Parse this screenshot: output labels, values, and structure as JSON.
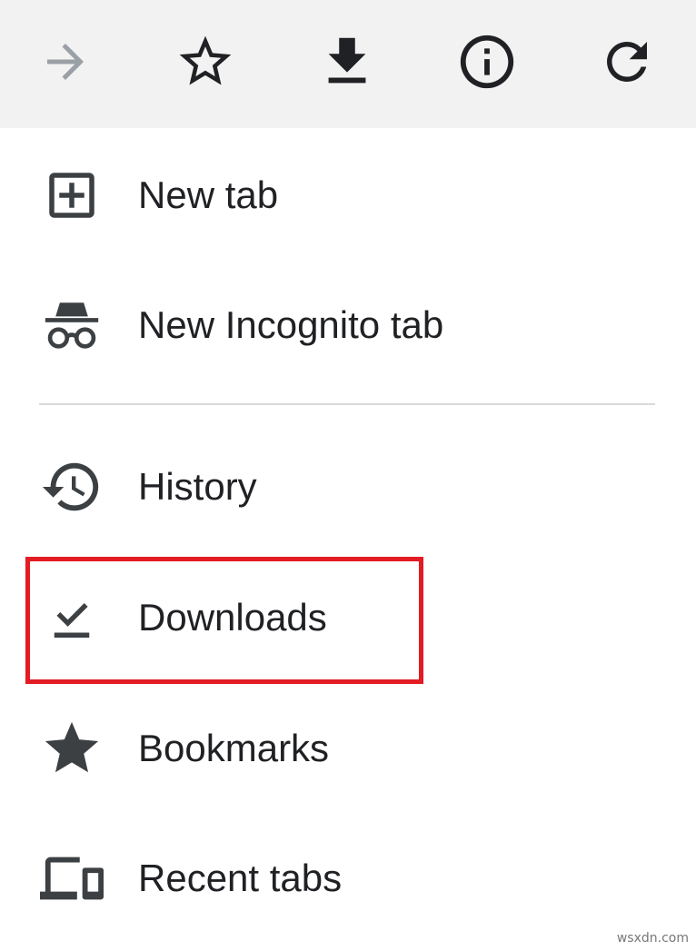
{
  "toolbar": {
    "buttons": [
      {
        "icon": "forward-arrow-icon",
        "enabled": false
      },
      {
        "icon": "star-outline-icon",
        "enabled": true
      },
      {
        "icon": "download-icon",
        "enabled": true
      },
      {
        "icon": "info-icon",
        "enabled": true
      },
      {
        "icon": "reload-icon",
        "enabled": true
      }
    ]
  },
  "menu": {
    "items": [
      {
        "label": "New tab",
        "icon": "new-tab-icon"
      },
      {
        "label": "New Incognito tab",
        "icon": "incognito-icon"
      },
      {
        "label": "History",
        "icon": "history-icon"
      },
      {
        "label": "Downloads",
        "icon": "downloads-check-icon",
        "highlighted": true
      },
      {
        "label": "Bookmarks",
        "icon": "star-filled-icon"
      },
      {
        "label": "Recent tabs",
        "icon": "devices-icon"
      }
    ]
  },
  "colors": {
    "toolbar_bg": "#f2f2f2",
    "icon": "#202124",
    "icon_disabled": "#9aa0a6",
    "highlight_border": "#e31b23"
  },
  "watermark": "wsxdn.com"
}
